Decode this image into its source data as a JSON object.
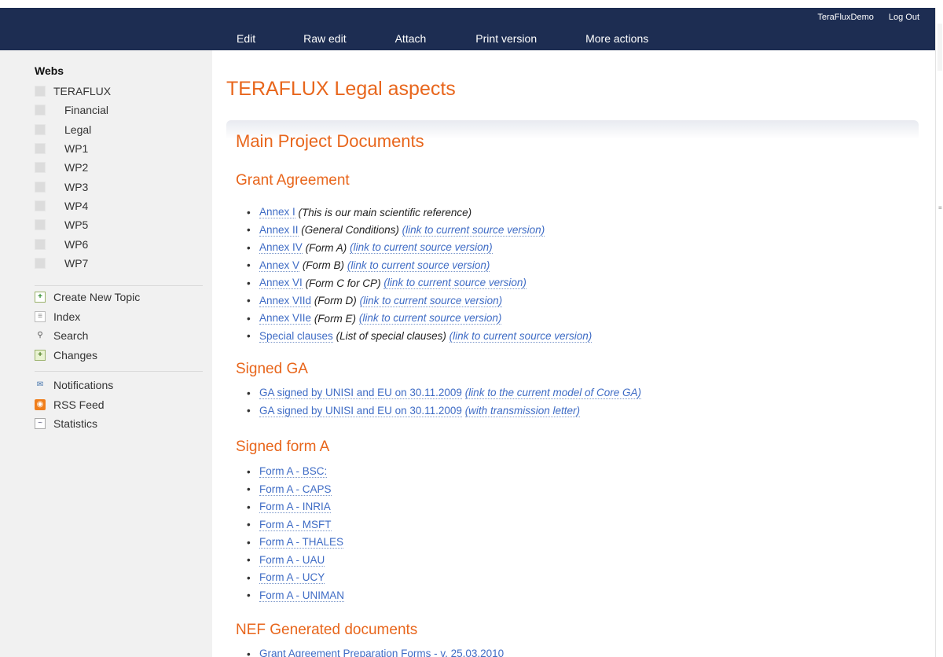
{
  "topbar": {
    "user": "TeraFluxDemo",
    "logout": "Log Out",
    "actions": [
      "Edit",
      "Raw edit",
      "Attach",
      "Print version",
      "More actions"
    ]
  },
  "sidebar": {
    "webs_title": "Webs",
    "webs": [
      "TERAFLUX",
      "Financial",
      "Legal",
      "WP1",
      "WP2",
      "WP3",
      "WP4",
      "WP5",
      "WP6",
      "WP7"
    ],
    "tools": [
      "Create New Topic",
      "Index",
      "Search",
      "Changes"
    ],
    "feeds": [
      "Notifications",
      "RSS Feed",
      "Statistics"
    ]
  },
  "main": {
    "title": "TERAFLUX Legal aspects",
    "section": "Main Project Documents",
    "grant": {
      "heading": "Grant Agreement",
      "items": [
        {
          "link": "Annex I",
          "note": "(This is our main scientific reference)"
        },
        {
          "link": "Annex II",
          "text": "(General Conditions)",
          "src": "(link to current source version)"
        },
        {
          "link": "Annex IV",
          "note": "(Form A)",
          "src": "(link to current source version)"
        },
        {
          "link": "Annex V",
          "note": "(Form B)",
          "src": "(link to current source version)"
        },
        {
          "link": "Annex VI",
          "note": "(Form C for CP)",
          "src": "(link to current source version)"
        },
        {
          "link": "Annex VIId",
          "note": "(Form D)",
          "src": "(link to current source version)"
        },
        {
          "link": "Annex VIIe",
          "note": "(Form E)",
          "src": "(link to current source version)"
        },
        {
          "link": "Special clauses",
          "note": "(List of special clauses)",
          "src": "(link to current source version)"
        }
      ]
    },
    "signed_ga": {
      "heading": "Signed GA",
      "items": [
        {
          "link": "GA signed by UNISI and EU on 30.11.2009",
          "src": "(link to the current model of Core GA)"
        },
        {
          "link": "GA signed by UNISI and EU on 30.11.2009",
          "src": "(with transmission letter)"
        }
      ]
    },
    "signed_form_a": {
      "heading": "Signed form A",
      "items": [
        "Form A - BSC:",
        "Form A - CAPS",
        "Form A - INRIA",
        "Form A - MSFT",
        "Form A - THALES",
        "Form A - UAU",
        "Form A - UCY",
        "Form A - UNIMAN"
      ]
    },
    "nef": {
      "heading": "NEF Generated documents",
      "items": [
        "Grant Agreement Preparation Forms - v. 25.03.2010"
      ]
    }
  }
}
